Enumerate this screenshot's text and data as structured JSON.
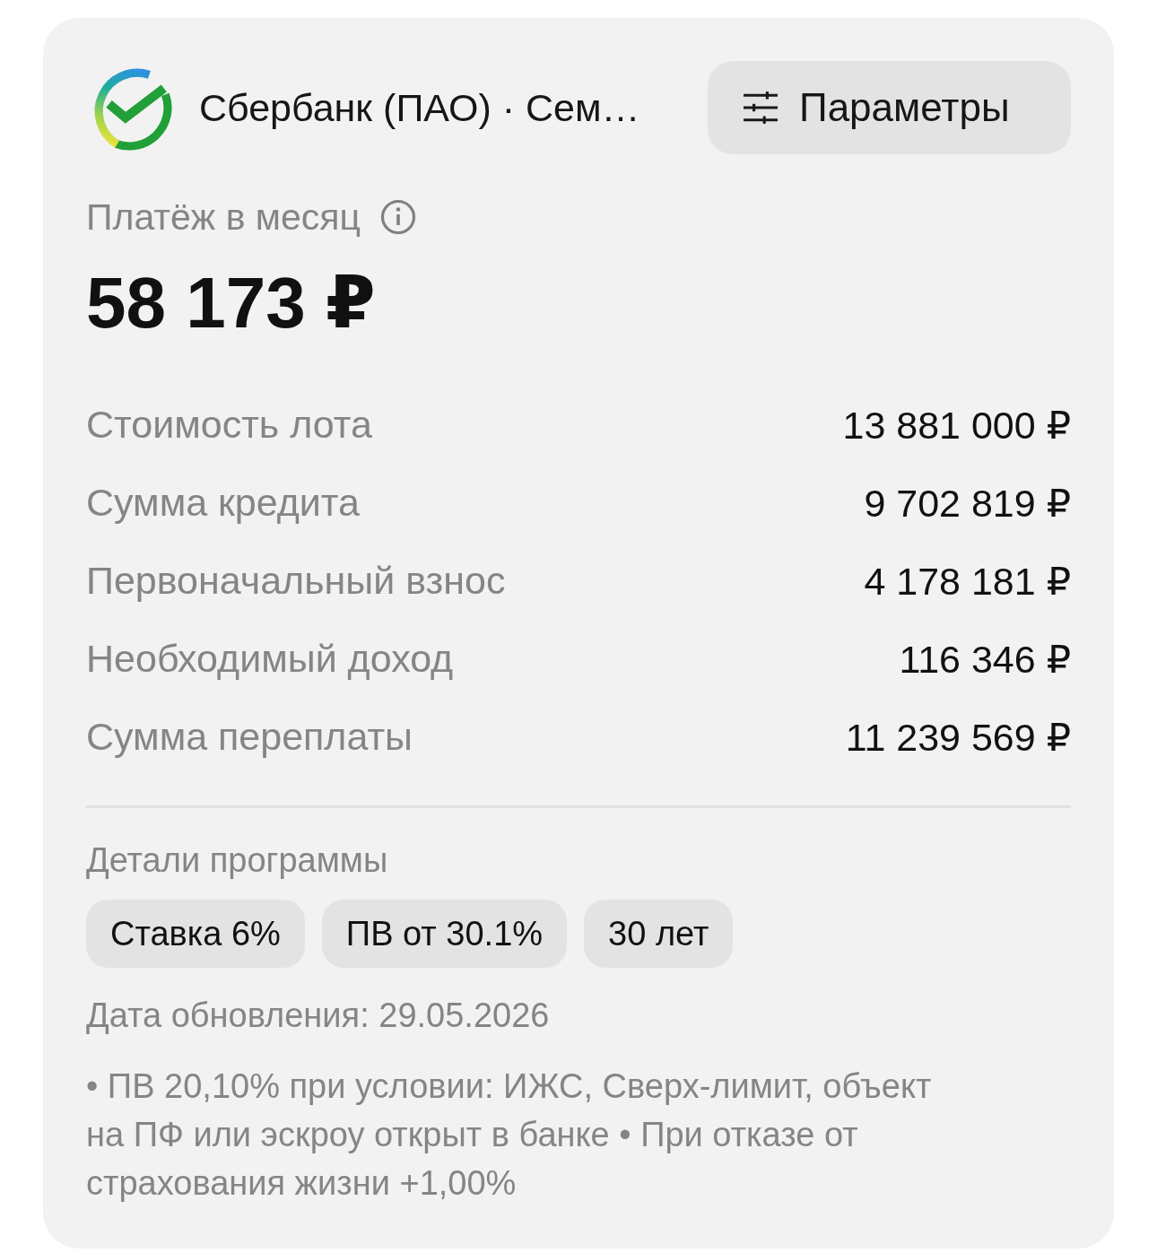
{
  "header": {
    "title": "Сбербанк (ПАО) · Сем…",
    "params_button": {
      "label": "Параметры"
    }
  },
  "payment": {
    "label": "Платёж в месяц",
    "amount": "58 173 ₽"
  },
  "summary": [
    {
      "label": "Стоимость лота",
      "value": "13 881 000 ₽"
    },
    {
      "label": "Сумма кредита",
      "value": "9 702 819 ₽"
    },
    {
      "label": "Первоначальный взнос",
      "value": "4 178 181 ₽"
    },
    {
      "label": "Необходимый доход",
      "value": "116 346 ₽"
    },
    {
      "label": "Сумма переплаты",
      "value": "11 239 569 ₽"
    }
  ],
  "details": {
    "title": "Детали программы",
    "tags": [
      "Ставка 6%",
      "ПВ от 30.1%",
      "30 лет"
    ],
    "updated": "Дата обновления: 29.05.2026",
    "note": "• ПВ 20,10% при условии: ИЖС, Сверх-лимит, объект на ПФ или эскроу открыт в банке • При отказе от страхования жизни +1,00%"
  }
}
